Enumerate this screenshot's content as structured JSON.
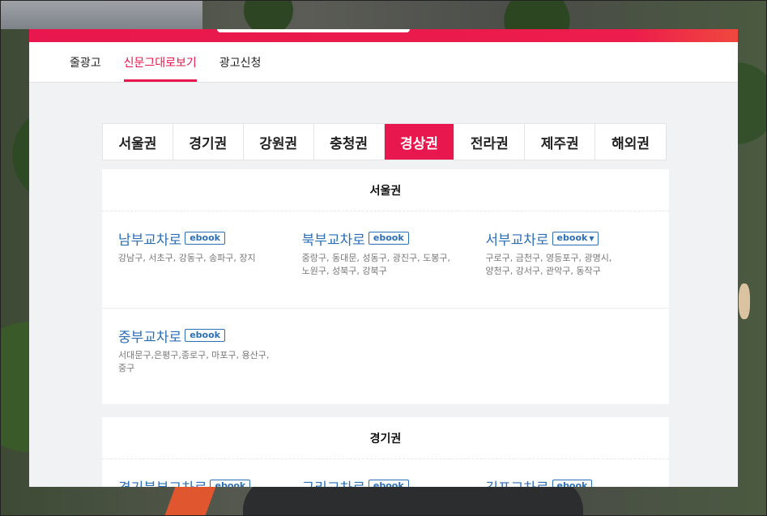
{
  "subnav": {
    "items": [
      {
        "label": "줄광고",
        "active": false
      },
      {
        "label": "신문그대로보기",
        "active": true
      },
      {
        "label": "광고신청",
        "active": false
      }
    ]
  },
  "tabs": [
    "서울권",
    "경기권",
    "강원권",
    "충청권",
    "경상권",
    "전라권",
    "제주권",
    "해외권"
  ],
  "active_tab": "경상권",
  "ebook_label": "ebook",
  "regions": [
    {
      "title": "서울권",
      "rows": [
        [
          {
            "name": "남부교차로",
            "areas": "강남구, 서초구, 강동구, 송파구, 장지"
          },
          {
            "name": "북부교차로",
            "areas": "중랑구, 동대문, 성동구, 광진구, 도봉구, 노원구, 성북구, 강북구"
          },
          {
            "name": "서부교차로",
            "areas": "구로구, 금천구, 영등포구, 광명시, 양천구, 강서구, 관악구, 동작구"
          }
        ],
        [
          {
            "name": "중부교차로",
            "areas": "서대문구,은평구,종로구, 마포구, 용산구, 중구"
          }
        ]
      ]
    },
    {
      "title": "경기권",
      "rows": [
        [
          {
            "name": "경기북부교차로",
            "areas": ""
          },
          {
            "name": "구리교차로",
            "areas": ""
          },
          {
            "name": "김포교차로",
            "areas": ""
          }
        ]
      ]
    }
  ],
  "colors": {
    "accent": "#e8174d",
    "link": "#2c6fb6"
  }
}
